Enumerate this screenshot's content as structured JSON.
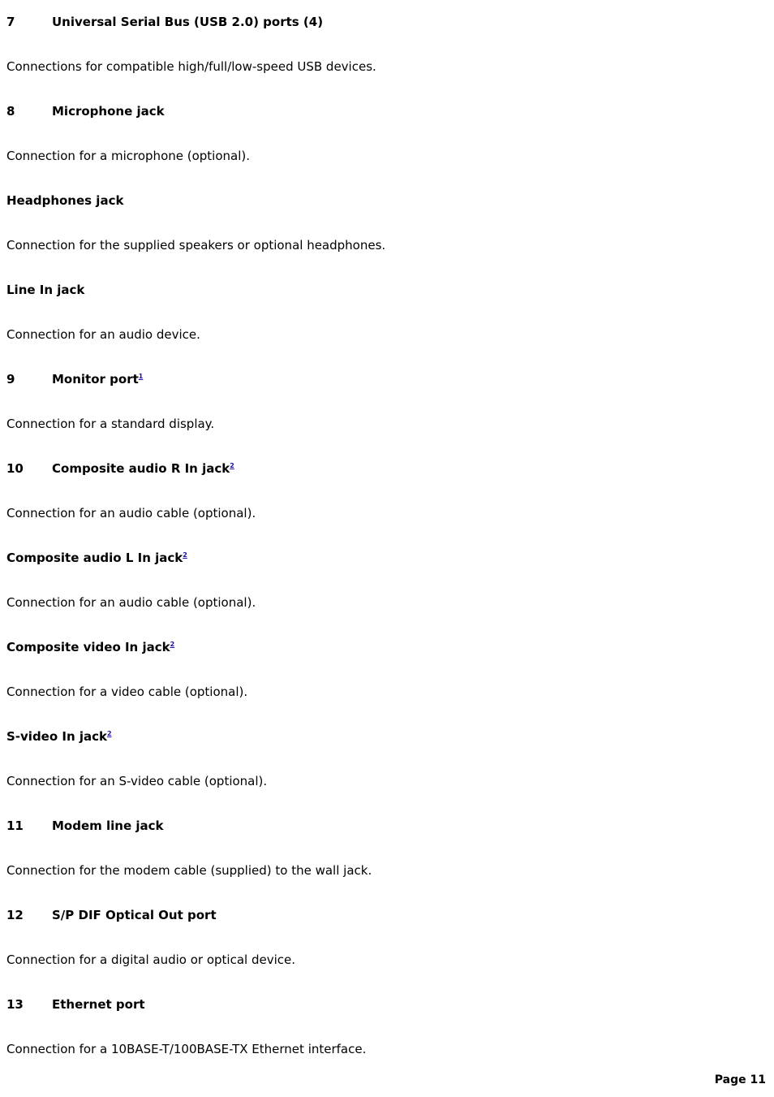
{
  "document": {
    "page_footer": "Page 11"
  },
  "entries": [
    {
      "number": "7",
      "label": "Universal Serial Bus (USB 2.0) ports (4)",
      "footnote": "",
      "description": "Connections for compatible high/full/low-speed USB devices."
    },
    {
      "number": "8",
      "label": "Microphone jack",
      "footnote": "",
      "description": "Connection for a microphone (optional)."
    },
    {
      "number": "",
      "label": "Headphones jack",
      "footnote": "",
      "description": "Connection for the supplied speakers or optional headphones."
    },
    {
      "number": "",
      "label": "Line In jack",
      "footnote": "",
      "description": "Connection for an audio device."
    },
    {
      "number": "9",
      "label": "Monitor port",
      "footnote": "1",
      "description": "Connection for a standard display."
    },
    {
      "number": "10",
      "label": "Composite audio R In jack",
      "footnote": "2",
      "description": "Connection for an audio cable (optional)."
    },
    {
      "number": "",
      "label": "Composite audio L In jack",
      "footnote": "2",
      "description": "Connection for an audio cable (optional)."
    },
    {
      "number": "",
      "label": "Composite video In jack",
      "footnote": "2",
      "description": "Connection for a video cable (optional)."
    },
    {
      "number": "",
      "label": "S-video In jack",
      "footnote": "2",
      "description": "Connection for an S-video cable (optional)."
    },
    {
      "number": "11",
      "label": "Modem line jack",
      "footnote": "",
      "description": "Connection for the modem cable (supplied) to the wall jack."
    },
    {
      "number": "12",
      "label": "S/P DIF Optical Out port",
      "footnote": "",
      "description": "Connection for a digital audio or optical device."
    },
    {
      "number": "13",
      "label": "Ethernet port",
      "footnote": "",
      "description": "Connection for a 10BASE-T/100BASE-TX Ethernet interface."
    }
  ],
  "colors": {
    "text": "#000000",
    "footnote_link": "#1a0dab",
    "background": "#ffffff"
  }
}
